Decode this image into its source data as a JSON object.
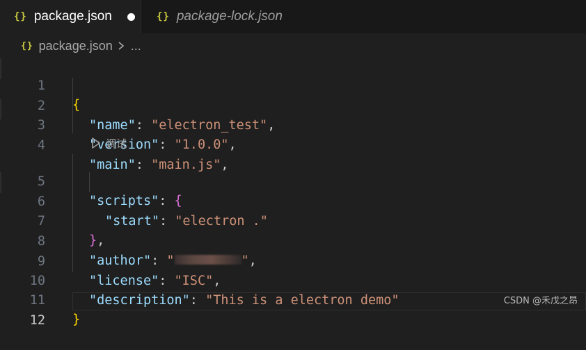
{
  "tabs": [
    {
      "icon": "{}",
      "label": "package.json",
      "active": true,
      "dirty": true
    },
    {
      "icon": "{}",
      "label": "package-lock.json",
      "active": false,
      "dirty": false
    }
  ],
  "breadcrumb": {
    "icon": "{}",
    "file": "package.json",
    "more": "..."
  },
  "codelens": {
    "label": "调试"
  },
  "lines": [
    {
      "n": "1"
    },
    {
      "n": "2"
    },
    {
      "n": "3"
    },
    {
      "n": "4"
    },
    {
      "n": "5"
    },
    {
      "n": "6"
    },
    {
      "n": "7"
    },
    {
      "n": "8"
    },
    {
      "n": "9"
    },
    {
      "n": "10"
    },
    {
      "n": "11"
    },
    {
      "n": "12"
    }
  ],
  "code": {
    "open": "{",
    "name_key": "\"name\"",
    "name_val": "\"electron_test\"",
    "version_key": "\"version\"",
    "version_val": "\"1.0.0\"",
    "main_key": "\"main\"",
    "main_val": "\"main.js\"",
    "scripts_key": "\"scripts\"",
    "scripts_open": "{",
    "start_key": "\"start\"",
    "start_val": "\"electron .\"",
    "scripts_close": "}",
    "author_key": "\"author\"",
    "author_val_open": "\"",
    "author_val_close": "\"",
    "license_key": "\"license\"",
    "license_val": "\"ISC\"",
    "description_key": "\"description\"",
    "description_val": "\"This is a electron demo\"",
    "close": "}",
    "colon": ": ",
    "comma": ","
  },
  "current_line": "12",
  "watermark": "CSDN @禾戊之昂",
  "colors": {
    "key": "#9cdcfe",
    "string": "#ce9178",
    "brace_level1": "#ffd700",
    "brace_level2": "#da70d6",
    "json_icon": "#cbcb41"
  }
}
